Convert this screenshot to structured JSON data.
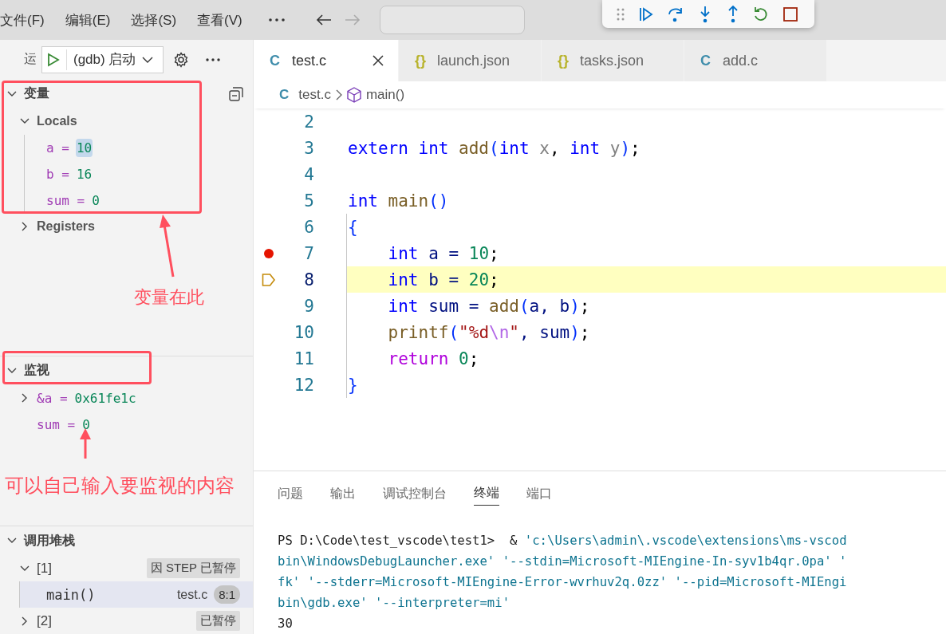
{
  "menu": [
    "文件(F)",
    "编辑(E)",
    "选择(S)",
    "查看(V)"
  ],
  "sidebar": {
    "title": "运",
    "config": "(gdb) 启动",
    "variables": {
      "title": "变量",
      "expanded": true,
      "scopes": [
        {
          "name": "Locals",
          "expanded": true,
          "children": [
            {
              "name": "a =",
              "value": "10",
              "highlighted": true
            },
            {
              "name": "b =",
              "value": "16",
              "highlighted": false
            },
            {
              "name": "sum =",
              "value": "0",
              "highlighted": false
            }
          ]
        },
        {
          "name": "Registers",
          "expanded": false
        }
      ]
    },
    "watch": {
      "title": "监视",
      "expanded": true,
      "items": [
        {
          "name": "&a =",
          "value": "0x61fe1c",
          "has_children": true
        },
        {
          "name": "sum =",
          "value": "0",
          "has_children": false
        }
      ]
    },
    "call_stack": {
      "title": "调用堆栈",
      "expanded": true,
      "threads": [
        {
          "name": "[1]",
          "expanded": true,
          "status": "因 STEP 已暂停",
          "children": [
            {
              "name": "main()",
              "file": "test.c",
              "position": "8:1",
              "selected": true
            }
          ]
        },
        {
          "name": "[2]",
          "expanded": false,
          "status": "已暂停"
        }
      ]
    }
  },
  "annotations": [
    {
      "text": "变量在此"
    },
    {
      "text": "可以自己输入要监视的内容"
    }
  ],
  "tabs": [
    {
      "icon": "C",
      "kind": "c",
      "label": "test.c",
      "selected": true
    },
    {
      "icon": "{}",
      "kind": "json",
      "label": "launch.json",
      "selected": false
    },
    {
      "icon": "{}",
      "kind": "json",
      "label": "tasks.json",
      "selected": false
    },
    {
      "icon": "C",
      "kind": "c",
      "label": "add.c",
      "selected": false
    }
  ],
  "breadcrumb": {
    "icon": "C",
    "file": "test.c",
    "symbol": "main()"
  },
  "code": [
    {
      "number": "2",
      "breakpoint": false,
      "current": false
    },
    {
      "number": "3",
      "breakpoint": false,
      "current": false,
      "tokens": [
        {
          "t": "extern int ",
          "color": "#0000ff"
        },
        {
          "t": "add",
          "color": "#795e26"
        },
        {
          "t": "(",
          "color": "#0431fa"
        },
        {
          "t": "int ",
          "color": "#0000ff"
        },
        {
          "t": "x",
          "color": "#808080"
        },
        {
          "t": ", ",
          "color": "#000000"
        },
        {
          "t": "int ",
          "color": "#0000ff"
        },
        {
          "t": "y",
          "color": "#808080"
        },
        {
          "t": ")",
          "color": "#0431fa"
        },
        {
          "t": ";",
          "color": "#000000"
        }
      ]
    },
    {
      "number": "4",
      "breakpoint": false,
      "current": false
    },
    {
      "number": "5",
      "breakpoint": false,
      "current": false,
      "tokens": [
        {
          "t": "int ",
          "color": "#0000ff"
        },
        {
          "t": "main",
          "color": "#795e26"
        },
        {
          "t": "()",
          "color": "#0431fa"
        }
      ]
    },
    {
      "number": "6",
      "breakpoint": false,
      "current": false,
      "tokens": [
        {
          "t": "{",
          "color": "#0431fa"
        }
      ]
    },
    {
      "number": "7",
      "breakpoint": true,
      "current": false,
      "tokens": [
        {
          "t": "    int ",
          "color": "#0000ff"
        },
        {
          "t": "a = ",
          "color": "#001080"
        },
        {
          "t": "10",
          "color": "#098658"
        },
        {
          "t": ";",
          "color": "#000000"
        }
      ]
    },
    {
      "number": "8",
      "breakpoint": false,
      "current": true,
      "tokens": [
        {
          "t": "    int ",
          "color": "#0000ff"
        },
        {
          "t": "b = ",
          "color": "#001080"
        },
        {
          "t": "20",
          "color": "#098658"
        },
        {
          "t": ";",
          "color": "#000000"
        }
      ]
    },
    {
      "number": "9",
      "breakpoint": false,
      "current": false,
      "tokens": [
        {
          "t": "    int ",
          "color": "#0000ff"
        },
        {
          "t": "sum = ",
          "color": "#001080"
        },
        {
          "t": "add",
          "color": "#795e26"
        },
        {
          "t": "(",
          "color": "#0431fa"
        },
        {
          "t": "a, b",
          "color": "#001080"
        },
        {
          "t": ")",
          "color": "#0431fa"
        },
        {
          "t": ";",
          "color": "#000000"
        }
      ]
    },
    {
      "number": "10",
      "breakpoint": false,
      "current": false,
      "tokens": [
        {
          "t": "    printf",
          "color": "#795e26"
        },
        {
          "t": "(",
          "color": "#0431fa"
        },
        {
          "t": "\"%d",
          "color": "#a31515"
        },
        {
          "t": "\\n",
          "color": "#b267e6"
        },
        {
          "t": "\"",
          "color": "#a31515"
        },
        {
          "t": ", sum",
          "color": "#001080"
        },
        {
          "t": ")",
          "color": "#0431fa"
        },
        {
          "t": ";",
          "color": "#000000"
        }
      ]
    },
    {
      "number": "11",
      "breakpoint": false,
      "current": false,
      "tokens": [
        {
          "t": "    return ",
          "color": "#af00db"
        },
        {
          "t": "0",
          "color": "#098658"
        },
        {
          "t": ";",
          "color": "#000000"
        }
      ]
    },
    {
      "number": "12",
      "breakpoint": false,
      "current": false,
      "tokens": [
        {
          "t": "}",
          "color": "#0431fa"
        }
      ]
    }
  ],
  "panel_tabs": [
    {
      "label": "问题",
      "selected": false
    },
    {
      "label": "输出",
      "selected": false
    },
    {
      "label": "调试控制台",
      "selected": false
    },
    {
      "label": "终端",
      "selected": true
    },
    {
      "label": "端口",
      "selected": false
    }
  ],
  "terminal": [
    [
      {
        "t": "PS D:\\Code\\test_vscode\\test1>  &",
        "color": "#1f1f1f"
      },
      {
        "t": " 'c:\\Users\\admin\\.vscode\\extensions\\ms-vscod",
        "color": "#0e7490"
      }
    ],
    [
      {
        "t": "bin\\WindowsDebugLauncher.exe' '--stdin=Microsoft-MIEngine-In-syv1b4qr.0pa' '",
        "color": "#0e7490"
      }
    ],
    [
      {
        "t": "fk' '--stderr=Microsoft-MIEngine-Error-wvrhuv2q.0zz' '--pid=Microsoft-MIEngi",
        "color": "#0e7490"
      }
    ],
    [
      {
        "t": "bin\\gdb.exe' '--interpreter=mi'",
        "color": "#0e7490"
      }
    ],
    [
      {
        "t": "30",
        "color": "#1f1f1f"
      }
    ]
  ]
}
